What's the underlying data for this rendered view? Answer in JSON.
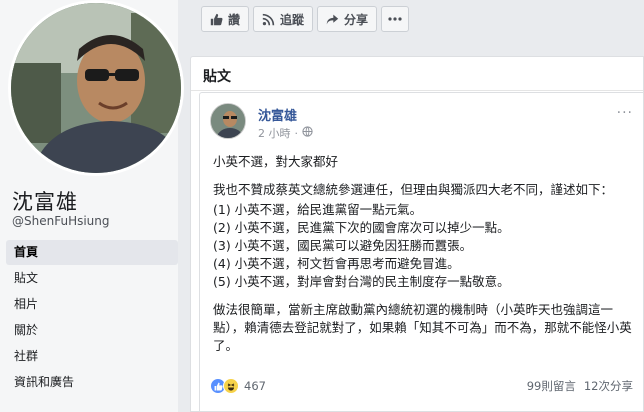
{
  "profile": {
    "name": "沈富雄",
    "handle": "@ShenFuHsiung"
  },
  "nav": {
    "items": [
      {
        "label": "首頁",
        "active": true
      },
      {
        "label": "貼文",
        "active": false
      },
      {
        "label": "相片",
        "active": false
      },
      {
        "label": "關於",
        "active": false
      },
      {
        "label": "社群",
        "active": false
      },
      {
        "label": "資訊和廣告",
        "active": false
      }
    ]
  },
  "actions": {
    "like_label": "讚",
    "follow_label": "追蹤",
    "share_label": "分享"
  },
  "posts_section": {
    "title": "貼文"
  },
  "post": {
    "author": "沈富雄",
    "time": "2 小時",
    "audience_separator": "·",
    "more": "···",
    "headline": "小英不選，對大家都好",
    "intro": "我也不贊成蔡英文總統參選連任，但理由與獨派四大老不同，謹述如下：",
    "points": [
      "(1) 小英不選，給民進黨留一點元氣。",
      "(2) 小英不選，民進黨下次的國會席次可以掉少一點。",
      "(3) 小英不選，國民黨可以避免因狂勝而囂張。",
      "(4) 小英不選，柯文哲會再思考而避免冒進。",
      "(5) 小英不選，對岸會對台灣的民主制度存一點敬意。"
    ],
    "conclusion": "做法很簡單，當新主席啟動黨內總統初選的機制時（小英昨天也強調這一點），賴清德去登記就對了，如果賴「知其不可為」而不為，那就不能怪小英了。",
    "reaction_count": "467",
    "comments": "99則留言",
    "shares": "12次分享"
  },
  "colors": {
    "link_blue": "#365899",
    "page_bg": "#e9ebee",
    "meta_gray": "#90949c"
  }
}
